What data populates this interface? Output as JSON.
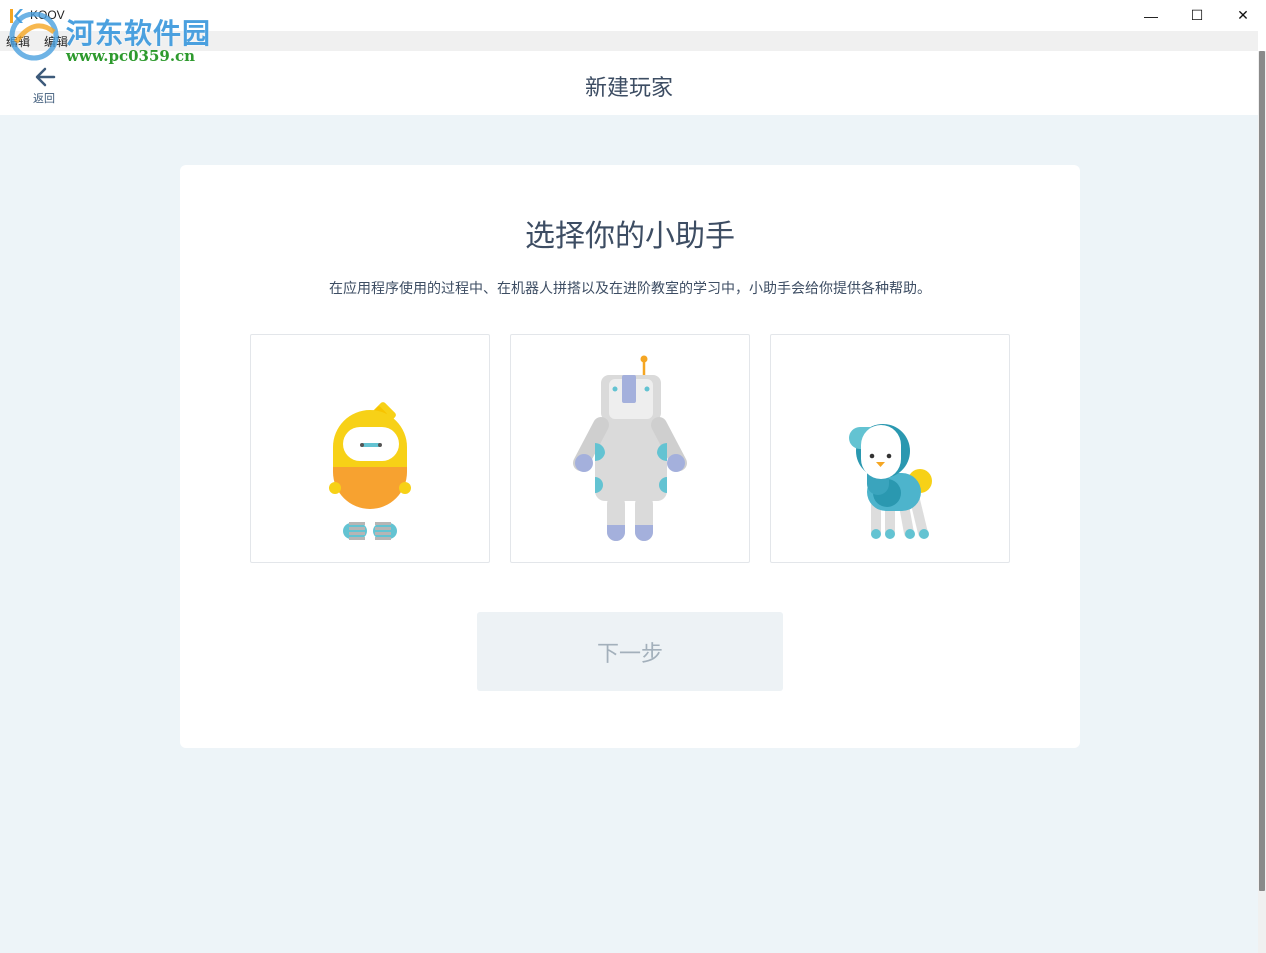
{
  "window": {
    "title": "KOOV",
    "buttons": {
      "minimize": "—",
      "maximize": "☐",
      "close": "✕"
    }
  },
  "menu": [
    "编辑",
    "编辑"
  ],
  "watermark": {
    "title": "河东软件园",
    "url": "www.pc0359.cn"
  },
  "header": {
    "back_label": "返回",
    "title": "新建玩家"
  },
  "card": {
    "heading": "选择你的小助手",
    "description": "在应用程序使用的过程中、在机器人拼搭以及在进阶教室的学习中，小助手会给你提供各种帮助。",
    "choices": [
      {
        "icon": "yellow-robot-helper-icon"
      },
      {
        "icon": "white-robot-helper-icon"
      },
      {
        "icon": "blue-animal-helper-icon"
      }
    ],
    "next_label": "下一步"
  },
  "colors": {
    "content_bg": "#edf4f8",
    "card_bg": "#ffffff",
    "title_text": "#3d4d63",
    "button_disabled_bg": "#edf2f5",
    "button_disabled_text": "#a3b0bb"
  }
}
